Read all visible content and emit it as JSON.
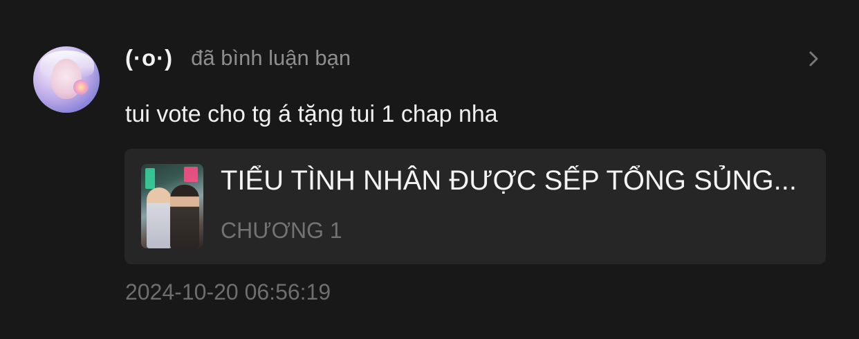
{
  "notification": {
    "username": "(·o·)",
    "action_text": "đã bình luận bạn",
    "comment": "tui vote cho tg á tặng tui 1 chap nha",
    "timestamp": "2024-10-20 06:56:19",
    "story_card": {
      "title": "TIỂU TÌNH NHÂN ĐƯỢC SẾP TỔNG SỦNG...",
      "chapter": "CHƯƠNG 1"
    }
  },
  "icons": {
    "chevron": "chevron-right-icon"
  },
  "colors": {
    "background": "#181818",
    "card_background": "#262626",
    "primary_text": "#f0f0f0",
    "secondary_text": "#8e8e8e",
    "muted_text": "#6e6e6e"
  }
}
